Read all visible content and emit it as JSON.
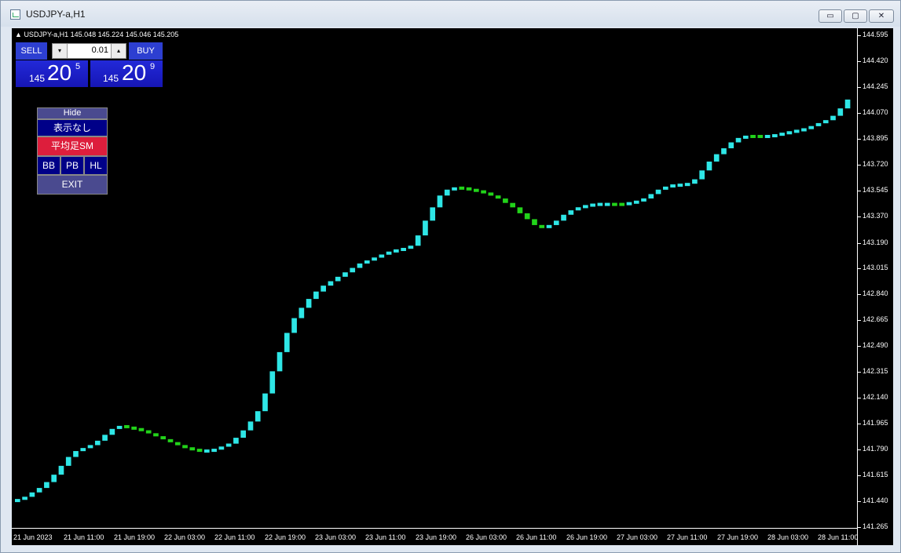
{
  "window": {
    "title": "USDJPY-a,H1",
    "buttons": {
      "minimize": "▭",
      "maximize": "▢",
      "close": "✕"
    }
  },
  "chart": {
    "symbol_line": "USDJPY-a,H1  145.048 145.224 145.046 145.205",
    "triangle": "▲"
  },
  "trade_panel": {
    "sell_label": "SELL",
    "buy_label": "BUY",
    "lot_value": "0.01",
    "spin_down": "▾",
    "spin_up": "▴",
    "sell_price": {
      "small": "145",
      "big": "20",
      "sup": "5"
    },
    "buy_price": {
      "small": "145",
      "big": "20",
      "sup": "9"
    }
  },
  "menu": {
    "hide": "Hide",
    "none": "表示なし",
    "heikin": "平均足SM",
    "bb": "BB",
    "pb": "PB",
    "hl": "HL",
    "exit": "EXIT"
  },
  "colors": {
    "up": "#2ee6e6",
    "down": "#22d31a",
    "background": "#000000",
    "grid": "#ffffff"
  },
  "chart_data": {
    "type": "bar",
    "symbol": "USDJPY-a",
    "timeframe": "H1",
    "y_ticks": [
      "144.595",
      "144.420",
      "144.245",
      "144.070",
      "143.895",
      "143.720",
      "143.545",
      "143.370",
      "143.190",
      "143.015",
      "142.840",
      "142.665",
      "142.490",
      "142.315",
      "142.140",
      "141.965",
      "141.790",
      "141.615",
      "141.440",
      "141.265"
    ],
    "x_ticks": [
      "21 Jun 2023",
      "21 Jun 11:00",
      "21 Jun 19:00",
      "22 Jun 03:00",
      "22 Jun 11:00",
      "22 Jun 19:00",
      "23 Jun 03:00",
      "23 Jun 11:00",
      "23 Jun 19:00",
      "26 Jun 03:00",
      "26 Jun 11:00",
      "26 Jun 19:00",
      "27 Jun 03:00",
      "27 Jun 11:00",
      "27 Jun 19:00",
      "28 Jun 03:00",
      "28 Jun 11:00"
    ],
    "ylim": [
      141.265,
      144.595
    ],
    "values": [
      141.45,
      141.47,
      141.5,
      141.53,
      141.57,
      141.62,
      141.68,
      141.74,
      141.78,
      141.8,
      141.82,
      141.85,
      141.89,
      141.93,
      141.95,
      141.94,
      141.93,
      141.92,
      141.9,
      141.88,
      141.86,
      141.84,
      141.82,
      141.8,
      141.79,
      141.78,
      141.78,
      141.79,
      141.81,
      141.83,
      141.87,
      141.92,
      141.98,
      142.05,
      142.17,
      142.32,
      142.45,
      142.58,
      142.68,
      142.75,
      142.81,
      142.86,
      142.9,
      142.93,
      142.96,
      142.99,
      143.02,
      143.05,
      143.07,
      143.09,
      143.11,
      143.13,
      143.14,
      143.15,
      143.17,
      143.24,
      143.34,
      143.43,
      143.51,
      143.55,
      143.56,
      143.56,
      143.55,
      143.54,
      143.53,
      143.51,
      143.49,
      143.46,
      143.43,
      143.39,
      143.35,
      143.31,
      143.29,
      143.31,
      143.34,
      143.38,
      143.41,
      143.43,
      143.44,
      143.45,
      143.45,
      143.45,
      143.45,
      143.45,
      143.46,
      143.47,
      143.49,
      143.52,
      143.55,
      143.57,
      143.58,
      143.58,
      143.59,
      143.62,
      143.68,
      143.74,
      143.79,
      143.83,
      143.87,
      143.9,
      143.91,
      143.91,
      143.91,
      143.91,
      143.92,
      143.93,
      143.94,
      143.95,
      143.96,
      143.98,
      144.0,
      144.02,
      144.05,
      144.1,
      144.16
    ],
    "colors": [
      "up",
      "up",
      "up",
      "up",
      "up",
      "up",
      "up",
      "up",
      "up",
      "up",
      "up",
      "up",
      "up",
      "up",
      "up",
      "down",
      "down",
      "down",
      "down",
      "down",
      "down",
      "down",
      "down",
      "down",
      "down",
      "down",
      "up",
      "up",
      "up",
      "up",
      "up",
      "up",
      "up",
      "up",
      "up",
      "up",
      "up",
      "up",
      "up",
      "up",
      "up",
      "up",
      "up",
      "up",
      "up",
      "up",
      "up",
      "up",
      "up",
      "up",
      "up",
      "up",
      "up",
      "up",
      "up",
      "up",
      "up",
      "up",
      "up",
      "up",
      "up",
      "down",
      "down",
      "down",
      "down",
      "down",
      "down",
      "down",
      "down",
      "down",
      "down",
      "down",
      "down",
      "up",
      "up",
      "up",
      "up",
      "up",
      "up",
      "up",
      "up",
      "up",
      "down",
      "down",
      "up",
      "up",
      "up",
      "up",
      "up",
      "up",
      "up",
      "up",
      "up",
      "up",
      "up",
      "up",
      "up",
      "up",
      "up",
      "up",
      "up",
      "down",
      "down",
      "up",
      "up",
      "up",
      "up",
      "up",
      "up",
      "up",
      "up",
      "up",
      "up",
      "up",
      "up"
    ]
  }
}
